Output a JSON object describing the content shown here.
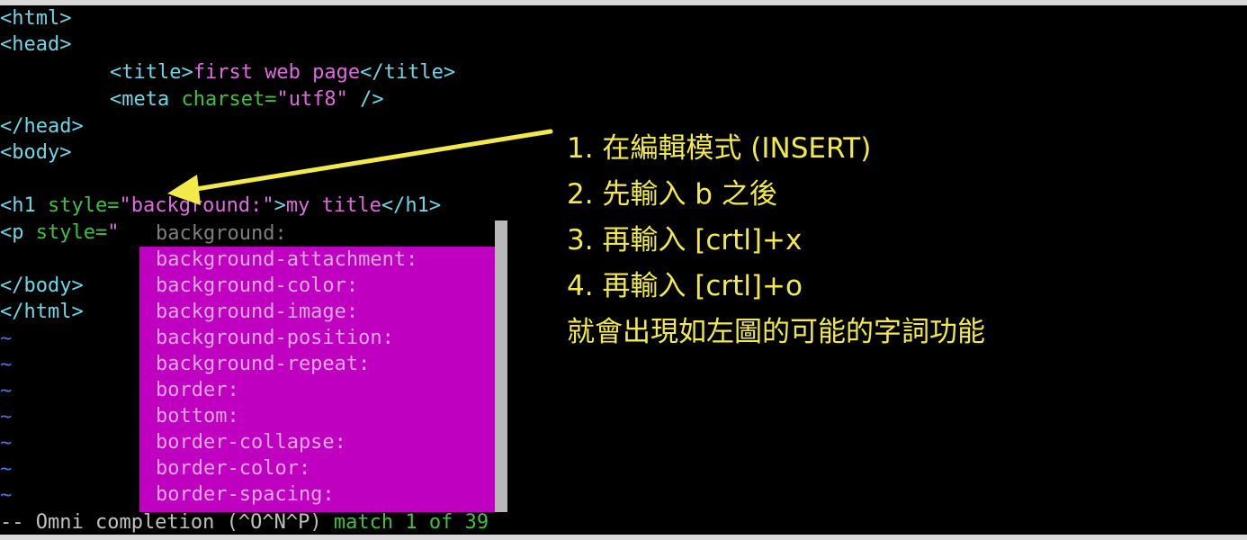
{
  "editor": {
    "l1": "<html>",
    "l2": "<head>",
    "l3_open": "<title>",
    "l3_text": "first web page",
    "l3_close": "</title>",
    "l4_a": "<meta ",
    "l4_b": "charset=",
    "l4_c": "\"utf8\"",
    "l4_d": " />",
    "l5": "</head>",
    "l6": "<body>",
    "l8_a": "<h1 ",
    "l8_b": "style=",
    "l8_c": "\"background:\"",
    "l8_d": ">",
    "l8_e": "my title",
    "l8_f": "</h1>",
    "l9_a": "<p ",
    "l9_b": "style=",
    "l9_c": "\" ",
    "l11": "</body>",
    "l12": "</html>",
    "tilde": "~"
  },
  "completion": {
    "items": [
      "background:",
      "background-attachment:",
      "background-color:",
      "background-image:",
      "background-position:",
      "background-repeat:",
      "border:",
      "bottom:",
      "border-collapse:",
      "border-color:",
      "border-spacing:"
    ]
  },
  "status": {
    "mode": "-- Omni completion (^O^N^P) ",
    "match": "match 1 of 39"
  },
  "annotation": {
    "lines": [
      "1. 在編輯模式 (INSERT)",
      "2. 先輸入 b 之後",
      "3. 再輸入 [crtl]+x",
      "4. 再輸入 [crtl]+o",
      "就會出現如左圖的可能的字詞功能"
    ],
    "arrow_color": "#f2e94a"
  }
}
